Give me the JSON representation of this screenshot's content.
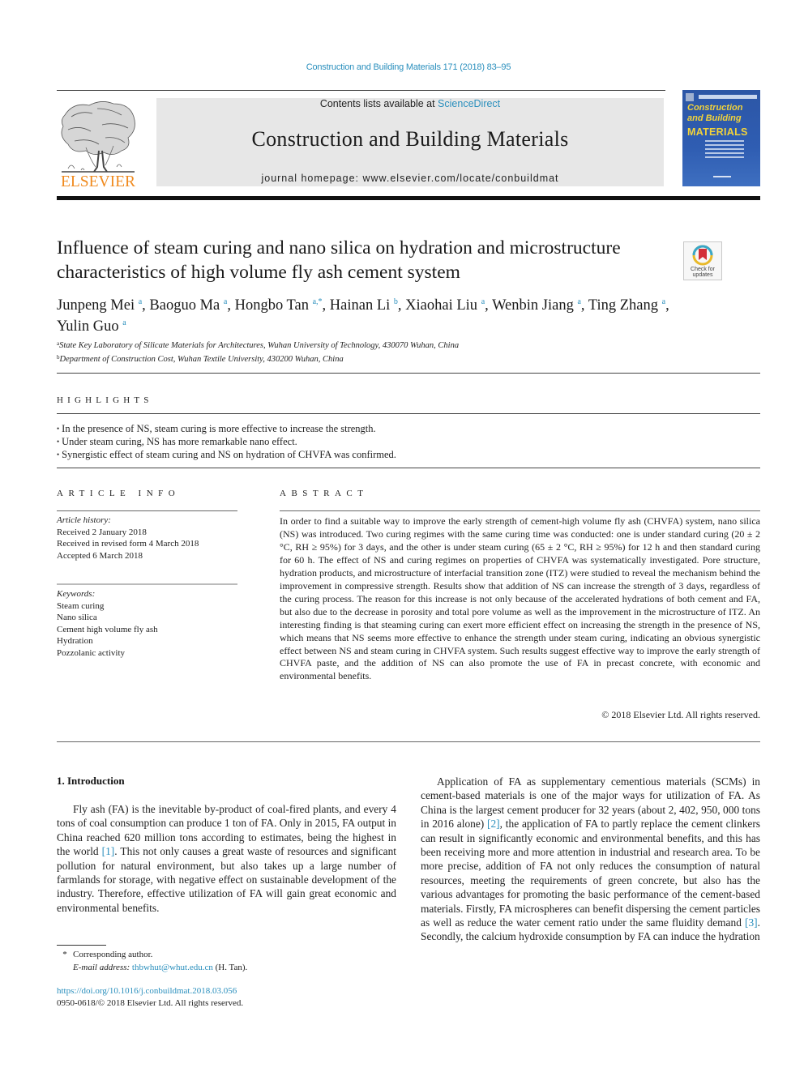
{
  "header": {
    "journal_reference": "Construction and Building Materials 171 (2018) 83–95",
    "contents_prefix": "Contents lists available at ",
    "contents_link": "ScienceDirect",
    "journal_name": "Construction and Building Materials",
    "homepage_line": "journal homepage: www.elsevier.com/locate/conbuildmat",
    "publisher_logo_text": "ELSEVIER",
    "cover": {
      "line1": "Construction",
      "line2": "and Building",
      "line3": "MATERIALS"
    },
    "colors": {
      "link": "#2a8fbd",
      "elsevier_orange": "#f08a1e",
      "banner_gray": "#e7e7e7",
      "cover_blue": "#2c56a6",
      "cover_yellow": "#f2d33a"
    }
  },
  "article": {
    "title": "Influence of steam curing and nano silica on hydration and microstructure characteristics of high volume fly ash cement system",
    "check_updates": {
      "line1": "Check for",
      "line2": "updates"
    },
    "authors": [
      {
        "name": "Junpeng Mei",
        "aff": "a"
      },
      {
        "name": "Baoguo Ma",
        "aff": "a"
      },
      {
        "name": "Hongbo Tan",
        "aff": "a,*"
      },
      {
        "name": "Hainan Li",
        "aff": "b"
      },
      {
        "name": "Xiaohai Liu",
        "aff": "a"
      },
      {
        "name": "Wenbin Jiang",
        "aff": "a"
      },
      {
        "name": "Ting Zhang",
        "aff": "a"
      },
      {
        "name": "Yulin Guo",
        "aff": "a"
      }
    ],
    "affiliations": [
      {
        "key": "a",
        "text": "State Key Laboratory of Silicate Materials for Architectures, Wuhan University of Technology, 430070 Wuhan, China"
      },
      {
        "key": "b",
        "text": "Department of Construction Cost, Wuhan Textile University, 430200 Wuhan, China"
      }
    ]
  },
  "highlights": {
    "heading": "HIGHLIGHTS",
    "items": [
      "In the presence of NS, steam curing is more effective to increase the strength.",
      "Under steam curing, NS has more remarkable nano effect.",
      "Synergistic effect of steam curing and NS on hydration of CHVFA was confirmed."
    ]
  },
  "article_info": {
    "heading": "ARTICLE INFO",
    "history_label": "Article history:",
    "history": [
      "Received 2 January 2018",
      "Received in revised form 4 March 2018",
      "Accepted 6 March 2018"
    ],
    "keywords_label": "Keywords:",
    "keywords": [
      "Steam curing",
      "Nano silica",
      "Cement high volume fly ash",
      "Hydration",
      "Pozzolanic activity"
    ]
  },
  "abstract": {
    "heading": "ABSTRACT",
    "text": "In order to find a suitable way to improve the early strength of cement-high volume fly ash (CHVFA) system, nano silica (NS) was introduced. Two curing regimes with the same curing time was conducted: one is under standard curing (20 ± 2 °C, RH ≥ 95%) for 3 days, and the other is under steam curing (65 ± 2 °C, RH ≥ 95%) for 12 h and then standard curing for 60 h. The effect of NS and curing regimes on properties of CHVFA was systematically investigated. Pore structure, hydration products, and microstructure of interfacial transition zone (ITZ) were studied to reveal the mechanism behind the improvement in compressive strength. Results show that addition of NS can increase the strength of 3 days, regardless of the curing process. The reason for this increase is not only because of the accelerated hydrations of both cement and FA, but also due to the decrease in porosity and total pore volume as well as the improvement in the microstructure of ITZ. An interesting finding is that steaming curing can exert more efficient effect on increasing the strength in the presence of NS, which means that NS seems more effective to enhance the strength under steam curing, indicating an obvious synergistic effect between NS and steam curing in CHVFA system. Such results suggest effective way to improve the early strength of CHVFA paste, and the addition of NS can also promote the use of FA in precast concrete, with economic and environmental benefits.",
    "copyright": "© 2018 Elsevier Ltd. All rights reserved."
  },
  "body": {
    "section_heading": "1. Introduction",
    "left_paragraph": {
      "before_ref": "Fly ash (FA) is the inevitable by-product of coal-fired plants, and every 4 tons of coal consumption can produce 1 ton of FA. Only in 2015, FA output in China reached 620 million tons according to estimates, being the highest in the world ",
      "ref": "[1]",
      "after_ref": ". This not only causes a great waste of resources and significant pollution for natural environment, but also takes up a large number of farmlands for storage, with negative effect on sustainable development of the industry. Therefore, effective utilization of FA will gain great economic and environmental benefits."
    },
    "right_paragraph": {
      "part1": "Application of FA as supplementary cementious materials (SCMs) in cement-based materials is one of the major ways for utilization of FA. As China is the largest cement producer for 32 years (about 2, 402, 950, 000 tons in 2016 alone) ",
      "ref1": "[2]",
      "part2": ", the application of FA to partly replace the cement clinkers can result in significantly economic and environmental benefits, and this has been receiving more and more attention in industrial and research area. To be more precise, addition of FA not only reduces the consumption of natural resources, meeting the requirements of green concrete, but also has the various advantages for promoting the basic performance of the cement-based materials. Firstly, FA microspheres can benefit dispersing the cement particles as well as reduce the water cement ratio under the same fluidity demand ",
      "ref2": "[3]",
      "part3": ". Secondly, the calcium hydroxide consumption by FA can induce the hydration"
    }
  },
  "footnotes": {
    "star": "*",
    "corresponding": "Corresponding author.",
    "email_label": "E-mail address:",
    "email": "thbwhut@whut.edu.cn",
    "email_suffix": " (H. Tan).",
    "doi": "https://doi.org/10.1016/j.conbuildmat.2018.03.056",
    "issn_copyright": "0950-0618/© 2018 Elsevier Ltd. All rights reserved."
  }
}
